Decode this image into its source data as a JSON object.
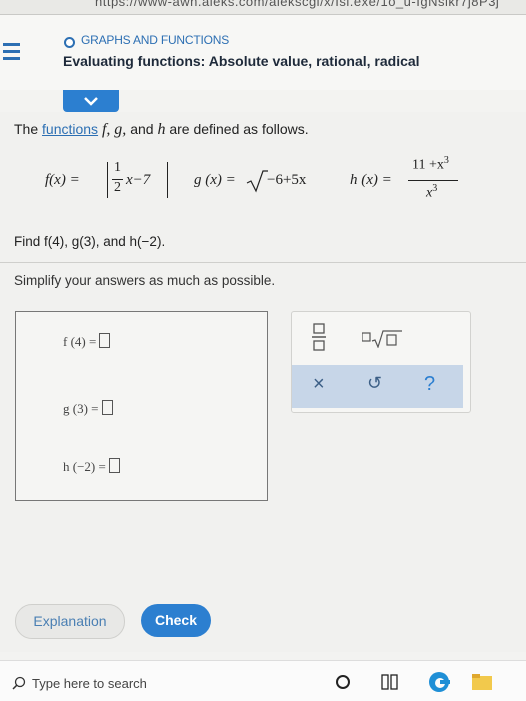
{
  "browser": {
    "url_fragment": "https://www-awn.aleks.com/alekscgi/x/Isl.exe/1o_u-IgNslkr7j8P3j"
  },
  "header": {
    "topic": "GRAPHS AND FUNCTIONS",
    "title": "Evaluating functions: Absolute value, rational, radical"
  },
  "problem": {
    "intro_prefix": "The",
    "intro_link": "functions",
    "intro_suffix": "are defined as follows.",
    "vars": [
      "f,",
      "g,",
      "and",
      "h"
    ],
    "f_lhs": "f(x) =",
    "f_num": "1",
    "f_den": "2",
    "f_rest": "x−7",
    "g_lhs": "g (x) =",
    "g_rad": "−6+5x",
    "h_lhs": "h (x) =",
    "h_num": "11 +x",
    "h_num_exp": "3",
    "h_den": "x",
    "h_den_exp": "3",
    "find_text": "Find f(4), g(3), and h(−2).",
    "simplify_text": "Simplify your answers as much as possible."
  },
  "answers": [
    {
      "label": "f (4) ="
    },
    {
      "label": "g (3) ="
    },
    {
      "label": "h (−2) ="
    }
  ],
  "tools": {
    "times": "×",
    "undo": "↺",
    "help": "?"
  },
  "buttons": {
    "explanation": "Explanation",
    "check": "Check"
  },
  "taskbar": {
    "search_placeholder": "Type here to search"
  }
}
